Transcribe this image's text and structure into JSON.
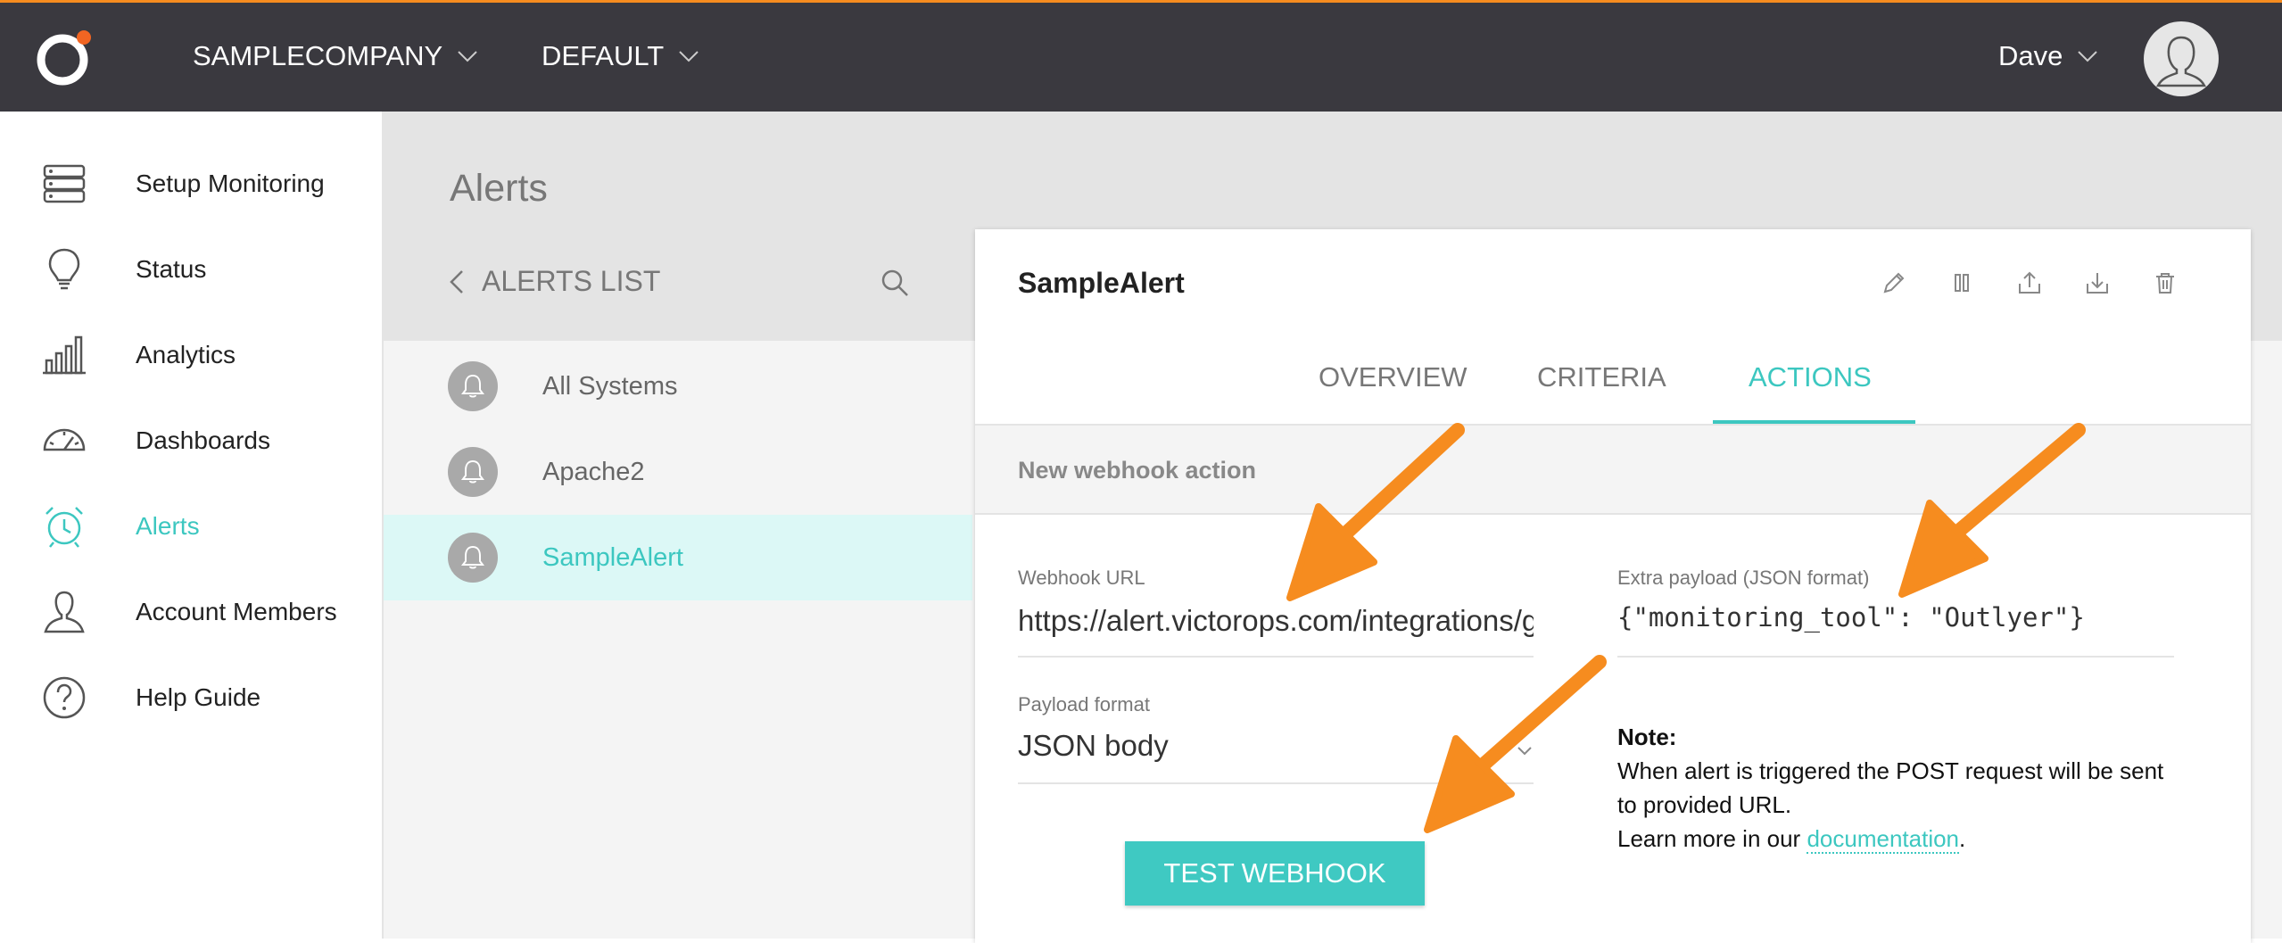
{
  "brand": {
    "accent": "#3cc7c0",
    "topbar": "#3a393f",
    "arrow": "#f68c1f"
  },
  "topbar": {
    "company": "SAMPLECOMPANY",
    "environment": "DEFAULT",
    "user": "Dave"
  },
  "sidebar": {
    "items": [
      {
        "label": "Setup Monitoring",
        "icon": "server-icon"
      },
      {
        "label": "Status",
        "icon": "lightbulb-icon"
      },
      {
        "label": "Analytics",
        "icon": "bar-chart-icon"
      },
      {
        "label": "Dashboards",
        "icon": "gauge-icon"
      },
      {
        "label": "Alerts",
        "icon": "alarm-clock-icon",
        "active": true
      },
      {
        "label": "Account Members",
        "icon": "user-icon"
      },
      {
        "label": "Help Guide",
        "icon": "help-icon"
      }
    ]
  },
  "main": {
    "title": "Alerts",
    "list_title": "ALERTS LIST",
    "alerts": [
      {
        "label": "All Systems"
      },
      {
        "label": "Apache2"
      },
      {
        "label": "SampleAlert",
        "selected": true
      }
    ]
  },
  "card": {
    "title": "SampleAlert",
    "tabs": [
      "OVERVIEW",
      "CRITERIA",
      "ACTIONS"
    ],
    "active_tab": "ACTIONS",
    "section": "New webhook action",
    "webhook_url_label": "Webhook URL",
    "webhook_url_value": "https://alert.victorops.com/integrations/generic",
    "payload_label": "Extra payload (JSON format)",
    "payload_value": "{\"monitoring_tool\": \"Outlyer\"}",
    "format_label": "Payload format",
    "format_value": "JSON body",
    "note_title": "Note:",
    "note_text": "When alert is triggered the POST request will be sent to provided URL.",
    "note_more": "Learn more in our ",
    "note_link": "documentation",
    "note_end": ".",
    "test_button": "TEST WEBHOOK"
  }
}
